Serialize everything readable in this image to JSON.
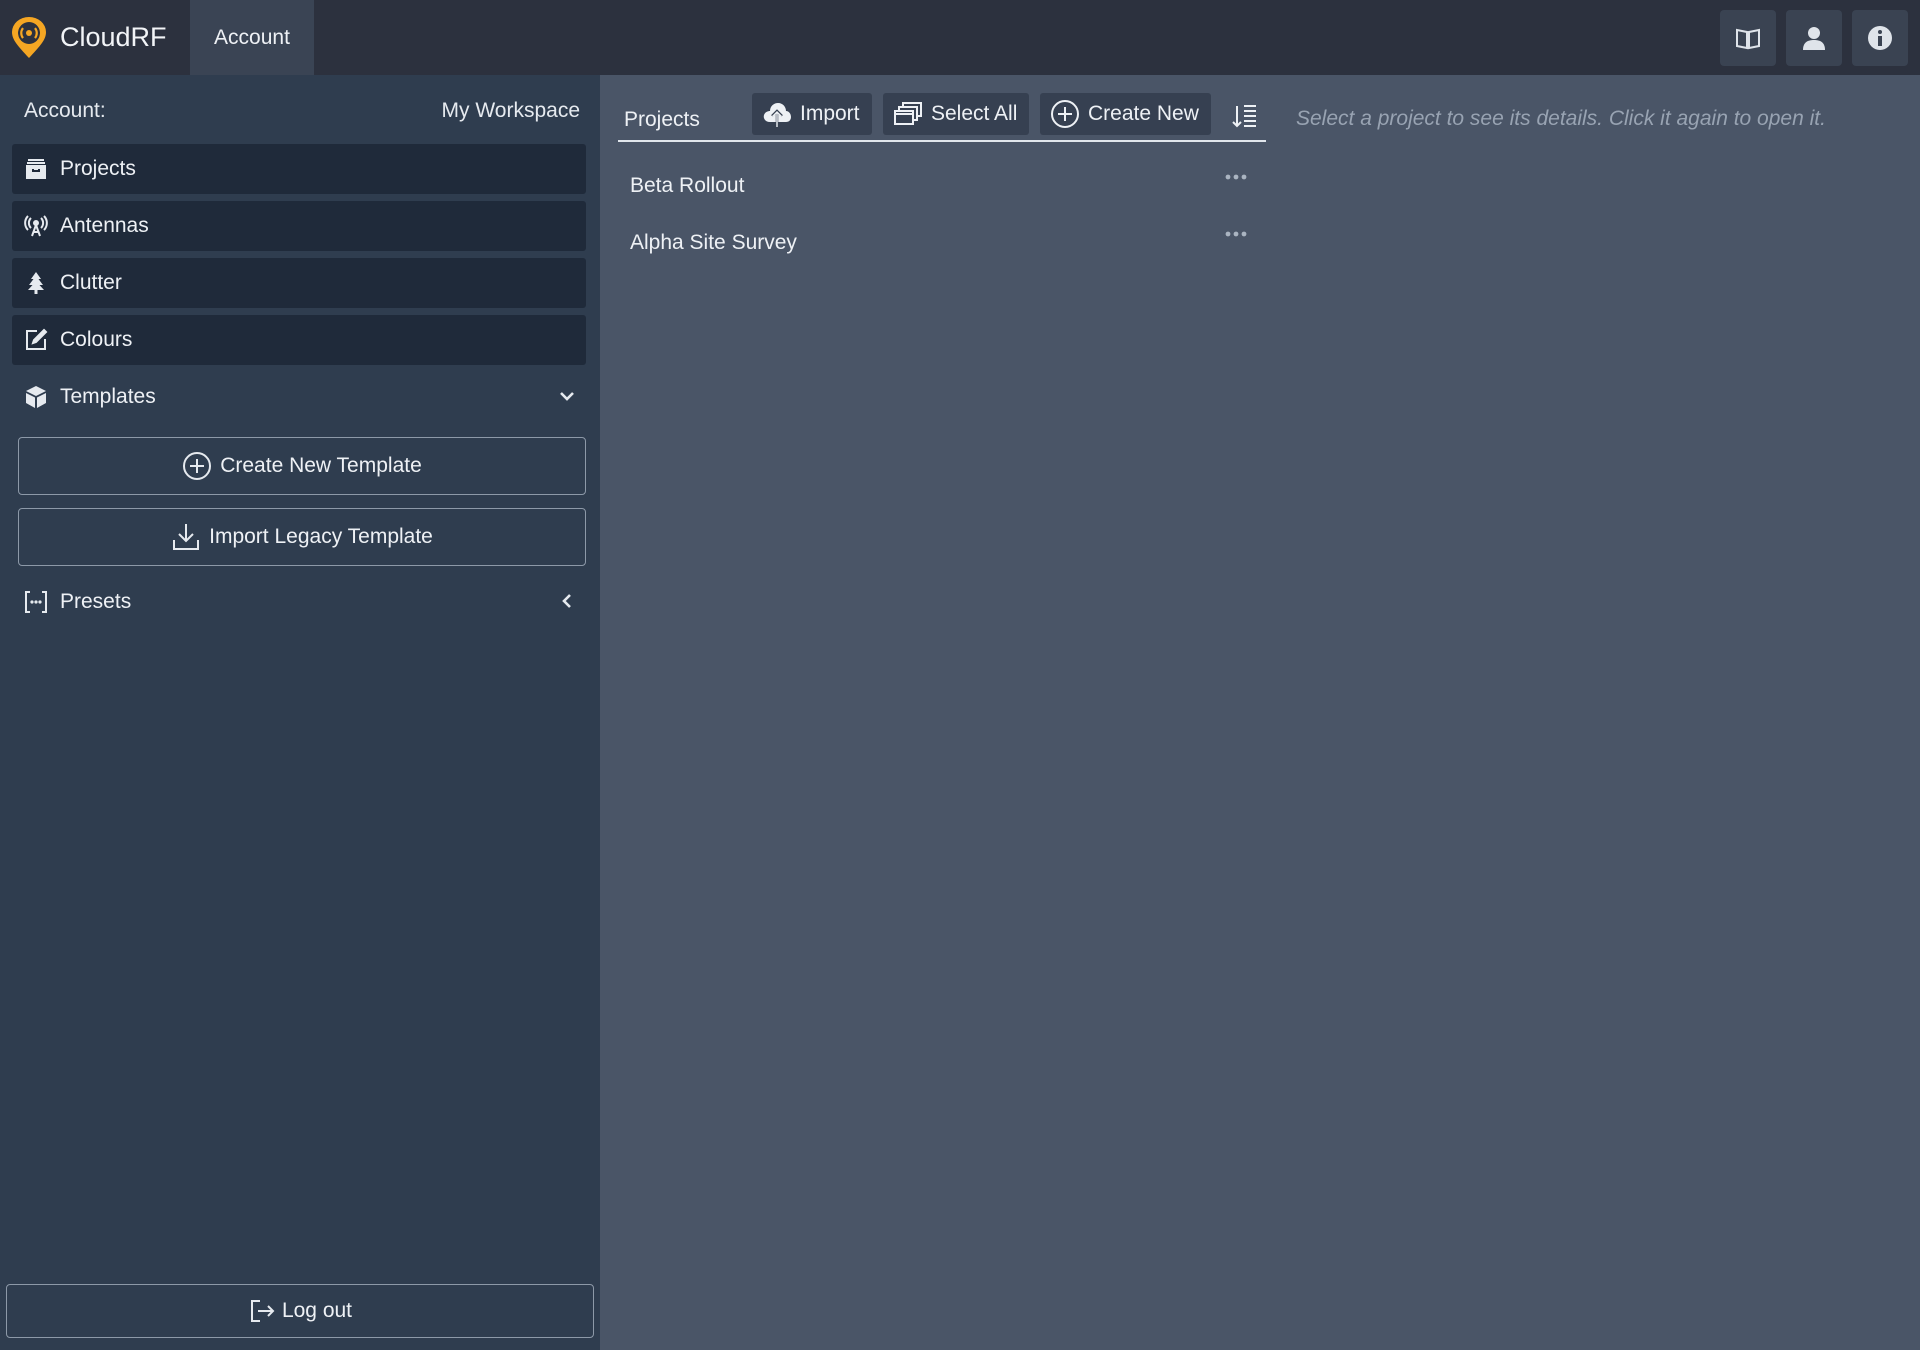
{
  "brand": {
    "name": "CloudRF",
    "accent": "#f5a623"
  },
  "top_tabs": [
    {
      "label": "Account",
      "active": true
    }
  ],
  "top_actions": [
    {
      "icon": "book-icon"
    },
    {
      "icon": "user-icon"
    },
    {
      "icon": "info-icon"
    }
  ],
  "sidebar": {
    "account_label": "Account:",
    "workspace": "My Workspace",
    "items": [
      {
        "label": "Projects",
        "icon": "archive-icon"
      },
      {
        "label": "Antennas",
        "icon": "antenna-icon"
      },
      {
        "label": "Clutter",
        "icon": "tree-icon"
      },
      {
        "label": "Colours",
        "icon": "edit-square-icon"
      }
    ],
    "templates": {
      "label": "Templates",
      "create_label": "Create New Template",
      "import_label": "Import Legacy Template"
    },
    "presets": {
      "label": "Presets"
    },
    "logout_label": "Log out"
  },
  "projects": {
    "title": "Projects",
    "import_label": "Import",
    "select_all_label": "Select All",
    "create_label": "Create New",
    "hint": "Select a project to see its details. Click it again to open it.",
    "items": [
      {
        "name": "Beta Rollout"
      },
      {
        "name": "Alpha Site Survey"
      }
    ]
  }
}
